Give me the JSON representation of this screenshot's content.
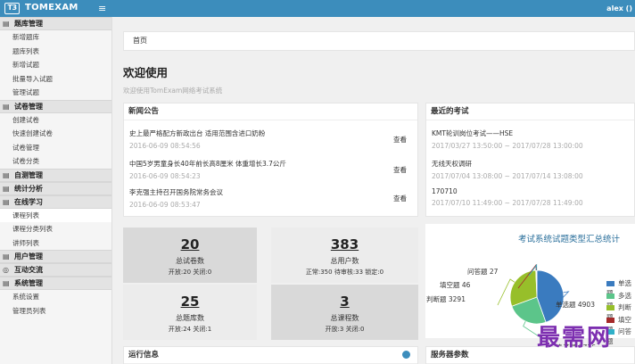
{
  "app": {
    "logo_mark": "T3",
    "logo_text": "TOMEXAM",
    "menu_icon": "≡",
    "user": "alex ()"
  },
  "sidebar": {
    "groups": [
      {
        "icon": "▤",
        "label": "题库管理",
        "items": [
          "新增题库",
          "题库列表",
          "新增试题",
          "批量导入试题",
          "管理试题"
        ]
      },
      {
        "icon": "▤",
        "label": "试卷管理",
        "items": [
          "创建试卷",
          "快速创建试卷",
          "试卷管理",
          "试卷分类"
        ]
      },
      {
        "icon": "▤",
        "label": "自测管理",
        "items": []
      },
      {
        "icon": "▤",
        "label": "统计分析",
        "items": []
      },
      {
        "icon": "▤",
        "label": "在线学习",
        "items": [
          "课程列表",
          "课程分类列表",
          "讲师列表"
        ]
      },
      {
        "icon": "▤",
        "label": "用户管理",
        "items": []
      },
      {
        "icon": "◎",
        "label": "互动交流",
        "items": []
      },
      {
        "icon": "▤",
        "label": "系统管理",
        "items": [
          "系统设置",
          "管理员列表"
        ]
      }
    ]
  },
  "breadcrumb": "首页",
  "welcome": {
    "title": "欢迎使用",
    "subtitle": "欢迎使用TomExam网络考试系统"
  },
  "news": {
    "title": "新闻公告",
    "view_label": "查看",
    "items": [
      {
        "title": "史上最严格配方新政出台 适用范围含进口奶粉",
        "date": "2016-06-09 08:54:56"
      },
      {
        "title": "中国5岁男童身长40年前长高8厘米 体重增长3.7公斤",
        "date": "2016-06-09 08:54:23"
      },
      {
        "title": "李克强主持召开国务院常务会议",
        "date": "2016-06-09 08:53:47"
      }
    ]
  },
  "exams": {
    "title": "最近的考试",
    "items": [
      {
        "title": "KMT轮训岗位考试——HSE",
        "date": "2017/03/27 13:50:00 ~ 2017/07/28 13:00:00"
      },
      {
        "title": "无线天权调研",
        "date": "2017/07/04 13:08:00 ~ 2017/07/14 13:08:00"
      },
      {
        "title": "170710",
        "date": "2017/07/10 11:49:00 ~ 2017/07/28 11:49:00"
      }
    ]
  },
  "stats": [
    {
      "num": "20",
      "label": "总试卷数",
      "detail": "开放:20 关闭:0"
    },
    {
      "num": "383",
      "label": "总用户数",
      "detail": "正常:350 待审核:33 锁定:0"
    },
    {
      "num": "25",
      "label": "总题库数",
      "detail": "开放:24 关闭:1"
    },
    {
      "num": "3",
      "label": "总课程数",
      "detail": "开放:3 关闭:0"
    }
  ],
  "chart_data": {
    "type": "pie",
    "title": "考试系统试题类型汇总统计",
    "categories": [
      "单选题",
      "多选题",
      "判断题",
      "填空题",
      "问答题"
    ],
    "values": [
      4903,
      2736,
      3291,
      46,
      27
    ],
    "colors": [
      "#3a7bbf",
      "#5cc58a",
      "#97bf2a",
      "#a52a2a",
      "#2fb0c8"
    ]
  },
  "bottom": {
    "run_info": "运行信息",
    "server_params": "服务器参数"
  },
  "watermark": "最需网"
}
